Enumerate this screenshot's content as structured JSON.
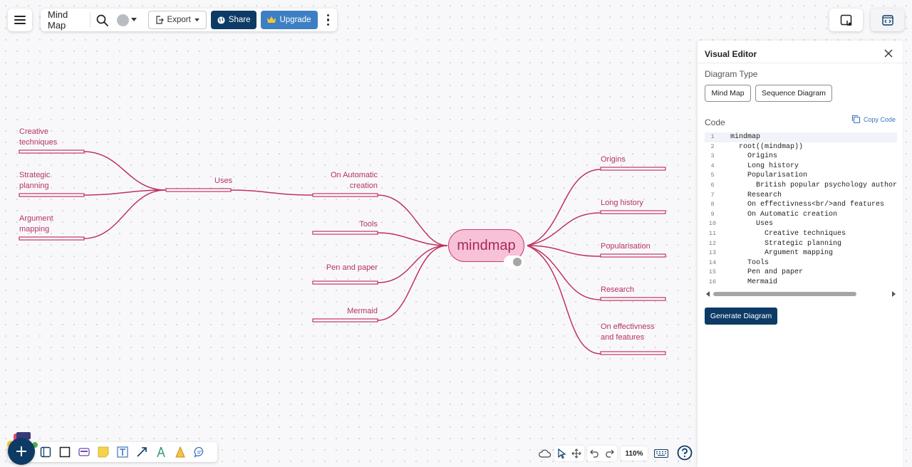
{
  "toolbar": {
    "title": "Mind Map",
    "export_label": "Export",
    "share_label": "Share",
    "upgrade_label": "Upgrade"
  },
  "mindmap": {
    "root": "mindmap",
    "nodes": {
      "creative_techniques": [
        "Creative",
        "techniques"
      ],
      "strategic_planning": [
        "Strategic",
        "planning"
      ],
      "argument_mapping": [
        "Argument",
        "mapping"
      ],
      "uses": "Uses",
      "on_automatic_creation": [
        "On Automatic",
        "creation"
      ],
      "tools": "Tools",
      "pen_and_paper": "Pen and paper",
      "mermaid": "Mermaid",
      "origins": "Origins",
      "long_history": "Long history",
      "popularisation": "Popularisation",
      "research": "Research",
      "on_effectivness": [
        "On effectivness",
        "and features"
      ]
    }
  },
  "panel": {
    "title": "Visual Editor",
    "diagram_type_label": "Diagram Type",
    "diagram_types": [
      "Mind Map",
      "Sequence Diagram"
    ],
    "code_label": "Code",
    "copy_code_label": "Copy Code",
    "code_lines": [
      "mindmap",
      "  root((mindmap))",
      "    Origins",
      "    Long history",
      "    Popularisation",
      "      British popular psychology author T",
      "    Research",
      "    On effectivness<br/>and features",
      "    On Automatic creation",
      "      Uses",
      "        Creative techniques",
      "        Strategic planning",
      "        Argument mapping",
      "    Tools",
      "    Pen and paper",
      "    Mermaid"
    ],
    "generate_label": "Generate Diagram"
  },
  "footer": {
    "zoom_label": "110%"
  },
  "colors": {
    "brand_dark": "#0d3b66",
    "upgrade_blue": "#3d7fc4",
    "edge_color": "#c0325f",
    "root_fill": "#f7c2d8",
    "label_color": "#b83166"
  },
  "icons": {
    "menu": "hamburger-icon",
    "search": "search-icon",
    "avatar": "user-avatar",
    "export": "export-icon",
    "share": "globe-icon",
    "upgrade": "crown-icon",
    "more": "more-vertical-icon",
    "close": "close-icon",
    "copy": "copy-icon",
    "help": "help-icon"
  }
}
